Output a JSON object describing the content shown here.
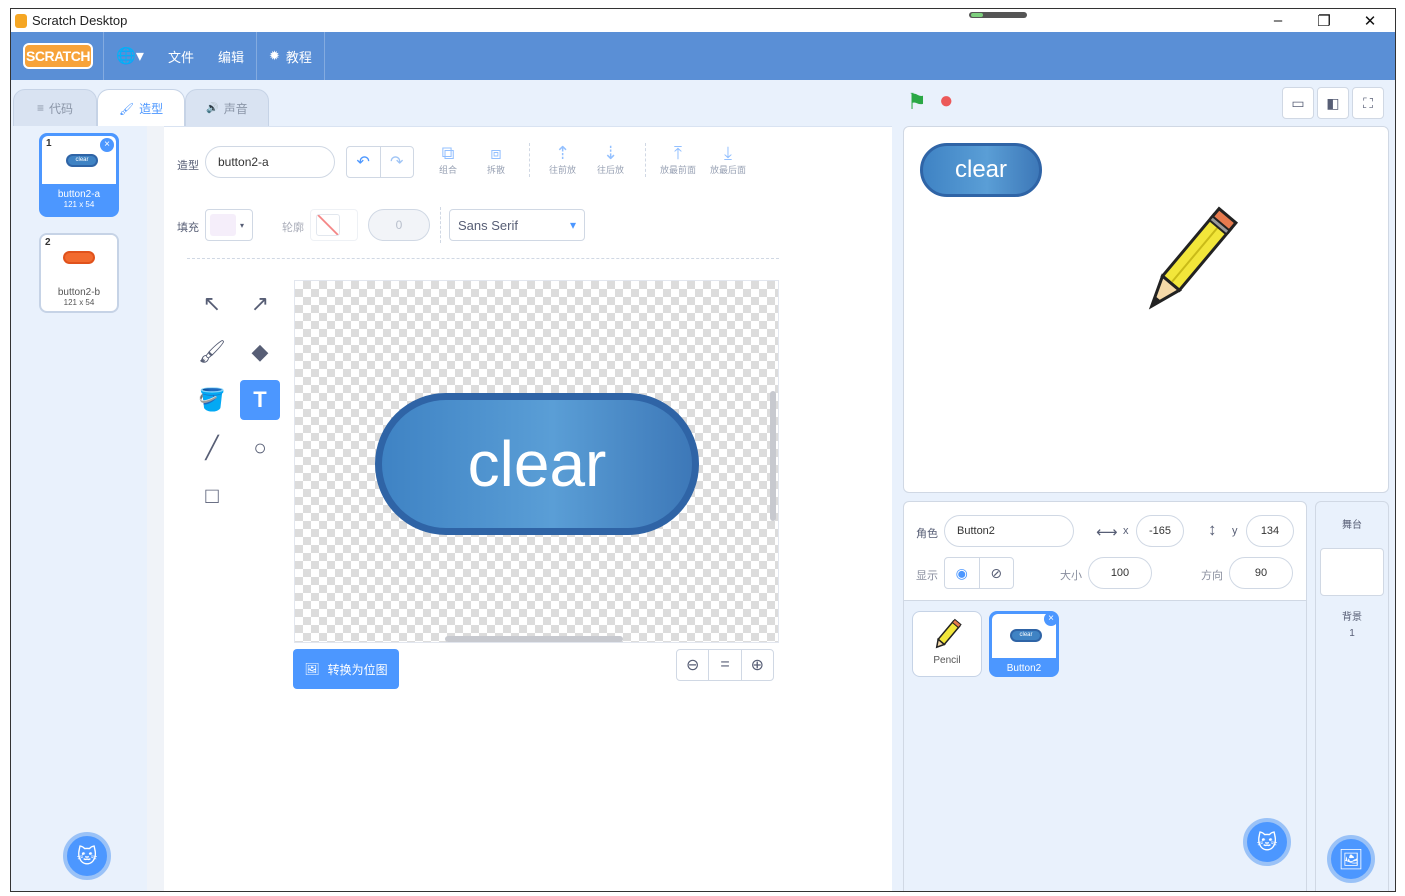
{
  "window": {
    "title": "Scratch Desktop",
    "minimize": "–",
    "restore": "❐",
    "close": "✕"
  },
  "menubar": {
    "logo": "SCRATCH",
    "language": "🌐▾",
    "file": "文件",
    "edit": "编辑",
    "tutorials": "教程"
  },
  "tabs": [
    {
      "icon": "≡",
      "label": "代码"
    },
    {
      "icon": "🖌",
      "label": "造型"
    },
    {
      "icon": "🔊",
      "label": "声音"
    }
  ],
  "costumes": [
    {
      "number": "1",
      "name": "button2-a",
      "size": "121 x 54",
      "thumb_text": "clear",
      "delete": "×"
    },
    {
      "number": "2",
      "name": "button2-b",
      "size": "121 x 54"
    }
  ],
  "editor": {
    "costume_label": "造型",
    "costume_name": "button2-a",
    "undo": "↶",
    "redo": "↷",
    "group": "组合",
    "ungroup": "拆散",
    "forward": "往前放",
    "backward": "往后放",
    "front": "放最前面",
    "back": "放最后面",
    "fill_label": "填充",
    "outline_label": "轮廓",
    "outline_width": "0",
    "font": "Sans Serif",
    "font_arrow": "▾",
    "canvas_text": "clear",
    "convert_bitmap": "转换为位图",
    "zoom_out": "⊖",
    "zoom_reset": "=",
    "zoom_in": "⊕",
    "tools": [
      "↖",
      "↗",
      "🖌",
      "◆",
      "🪣",
      "T",
      "╱",
      "○",
      "□"
    ]
  },
  "stage": {
    "flag": "⚑",
    "stop": "●",
    "button_text": "clear",
    "layout_small": "▭",
    "layout_normal": "◧",
    "fullscreen": "⛶"
  },
  "sprite_info": {
    "sprite_label": "角色",
    "sprite_name": "Button2",
    "x_label": "x",
    "x": "-165",
    "y_label": "y",
    "y": "134",
    "show_label": "显示",
    "size_label": "大小",
    "size": "100",
    "direction_label": "方向",
    "direction": "90"
  },
  "sprites": [
    {
      "name": "Pencil"
    },
    {
      "name": "Button2",
      "thumb_text": "clear",
      "delete": "×"
    }
  ],
  "stage_panel": {
    "title": "舞台",
    "backdrops_label": "背景",
    "backdrop_count": "1"
  },
  "colors": {
    "menubar": "#5a8fd6",
    "accent": "#4c97ff",
    "button_blue": "#3f83c4",
    "costume2_orange": "#f26a2e"
  }
}
